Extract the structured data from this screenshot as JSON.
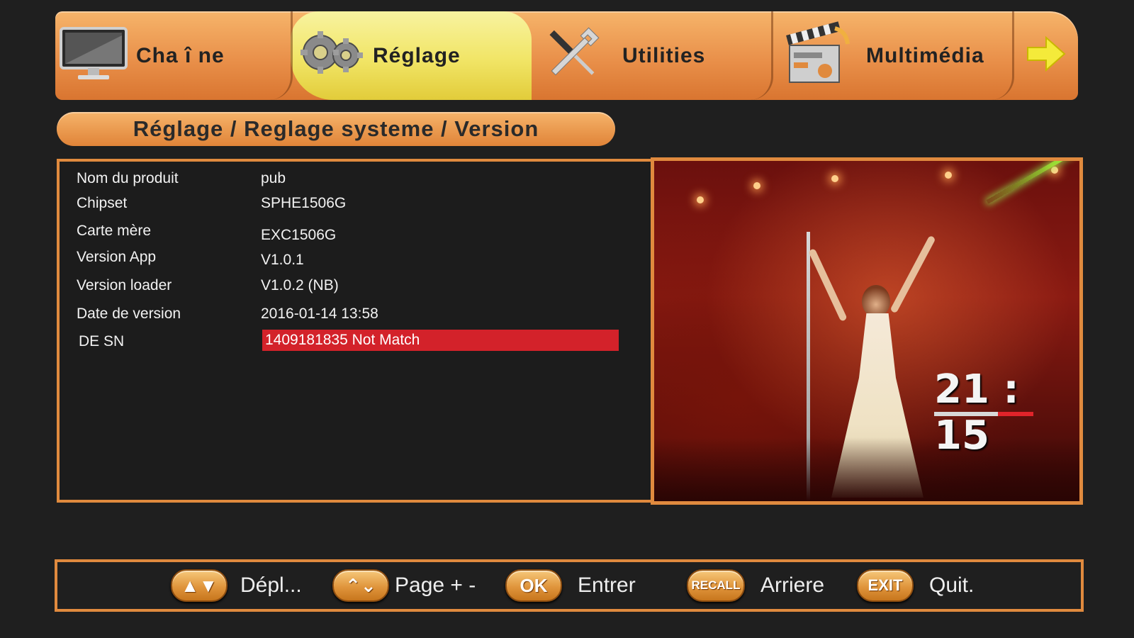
{
  "tabs": [
    {
      "label": "Cha î ne",
      "icon": "monitor-icon",
      "active": false
    },
    {
      "label": "Réglage",
      "icon": "gear-icon",
      "active": true
    },
    {
      "label": "Utilities",
      "icon": "tools-icon",
      "active": false
    },
    {
      "label": "Multimédia",
      "icon": "clapperboard-icon",
      "active": false
    }
  ],
  "next_icon": "arrow-right-icon",
  "breadcrumb": "Réglage / Reglage systeme / Version",
  "info": {
    "rows": [
      {
        "key": "Nom du produit",
        "value": "pub"
      },
      {
        "key": "Chipset",
        "value": "SPHE1506G"
      },
      {
        "key": "Carte mère",
        "value": "EXC1506G"
      },
      {
        "key": "Version App",
        "value": "V1.0.1"
      },
      {
        "key": "Version loader",
        "value": "V1.0.2 (NB)"
      },
      {
        "key": "Date de version",
        "value": "2016-01-14 13:58"
      }
    ],
    "sn": {
      "key": "DE SN",
      "value": "1409181835  Not Match",
      "highlight_color": "#d3222a"
    }
  },
  "preview": {
    "clock": "21 : 15"
  },
  "help": [
    {
      "key_label": "▲▼",
      "key_icon": "up-down-key-icon",
      "label": "Dépl..."
    },
    {
      "key_label": "⌃⌄",
      "key_icon": "page-key-icon",
      "label": "Page + -"
    },
    {
      "key_label": "OK",
      "key_icon": "ok-key-icon",
      "label": "Entrer"
    },
    {
      "key_label": "RECALL",
      "key_icon": "recall-key-icon",
      "label": "Arriere"
    },
    {
      "key_label": "EXIT",
      "key_icon": "exit-key-icon",
      "label": "Quit."
    }
  ],
  "colors": {
    "accent_orange": "#e08a3e",
    "active_tab": "#f1e566",
    "background": "#1f1f1f",
    "error_red": "#d3222a"
  }
}
